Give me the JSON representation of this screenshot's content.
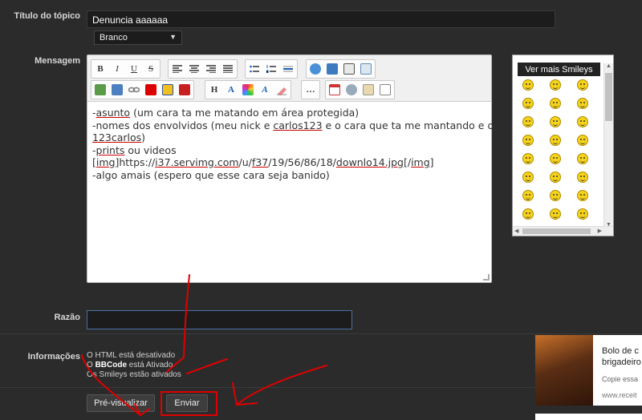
{
  "labels": {
    "topic_title": "Título do tópico",
    "message": "Mensagem",
    "reason": "Razão",
    "info": "Informações"
  },
  "topic_title_value": "Denuncia aaaaaa",
  "color_select": {
    "selected": "Branco"
  },
  "toolbar": {
    "row1": [
      "B",
      "I",
      "U",
      "S"
    ],
    "row2_letters": [
      "H",
      "A",
      "A"
    ]
  },
  "message_lines": [
    [
      "-",
      "asunto",
      " (um cara ta me matando em área protegida)"
    ],
    [
      "-nomes dos envolvidos (meu nick e ",
      "carlos123",
      " e o cara que ta me mantando e o"
    ],
    [
      "",
      "123carlos",
      ")"
    ],
    [
      "-",
      "prints",
      " ou videos"
    ],
    [
      " [",
      "img",
      "]https://",
      "i37.servimg.com",
      "/u/",
      "f37",
      "/19/56/86/18/",
      "downlo14.jpg",
      "[/",
      "img",
      "]"
    ],
    [
      "-algo amais (espero que esse cara seja banido)"
    ]
  ],
  "smileys": {
    "header": "Ver mais Smileys",
    "count": 24
  },
  "info_lines": [
    {
      "prefix": "O HTML está ",
      "bold": "",
      "suffix": "desativado"
    },
    {
      "prefix": "O ",
      "bold": "BBCode",
      "suffix": " está Ativado"
    },
    {
      "prefix": "Os Smileys estão ativados",
      "bold": "",
      "suffix": ""
    }
  ],
  "buttons": {
    "preview": "Pré-visualizar",
    "send": "Enviar"
  },
  "ad": {
    "title_line1": "Bolo de c",
    "title_line2": "brigadeiro",
    "subtitle": "Copie essa",
    "url": "www.receit"
  },
  "colors": {
    "background": "#2b2b2b",
    "annotation": "#e00000",
    "input_border": "#4a6fa5"
  }
}
